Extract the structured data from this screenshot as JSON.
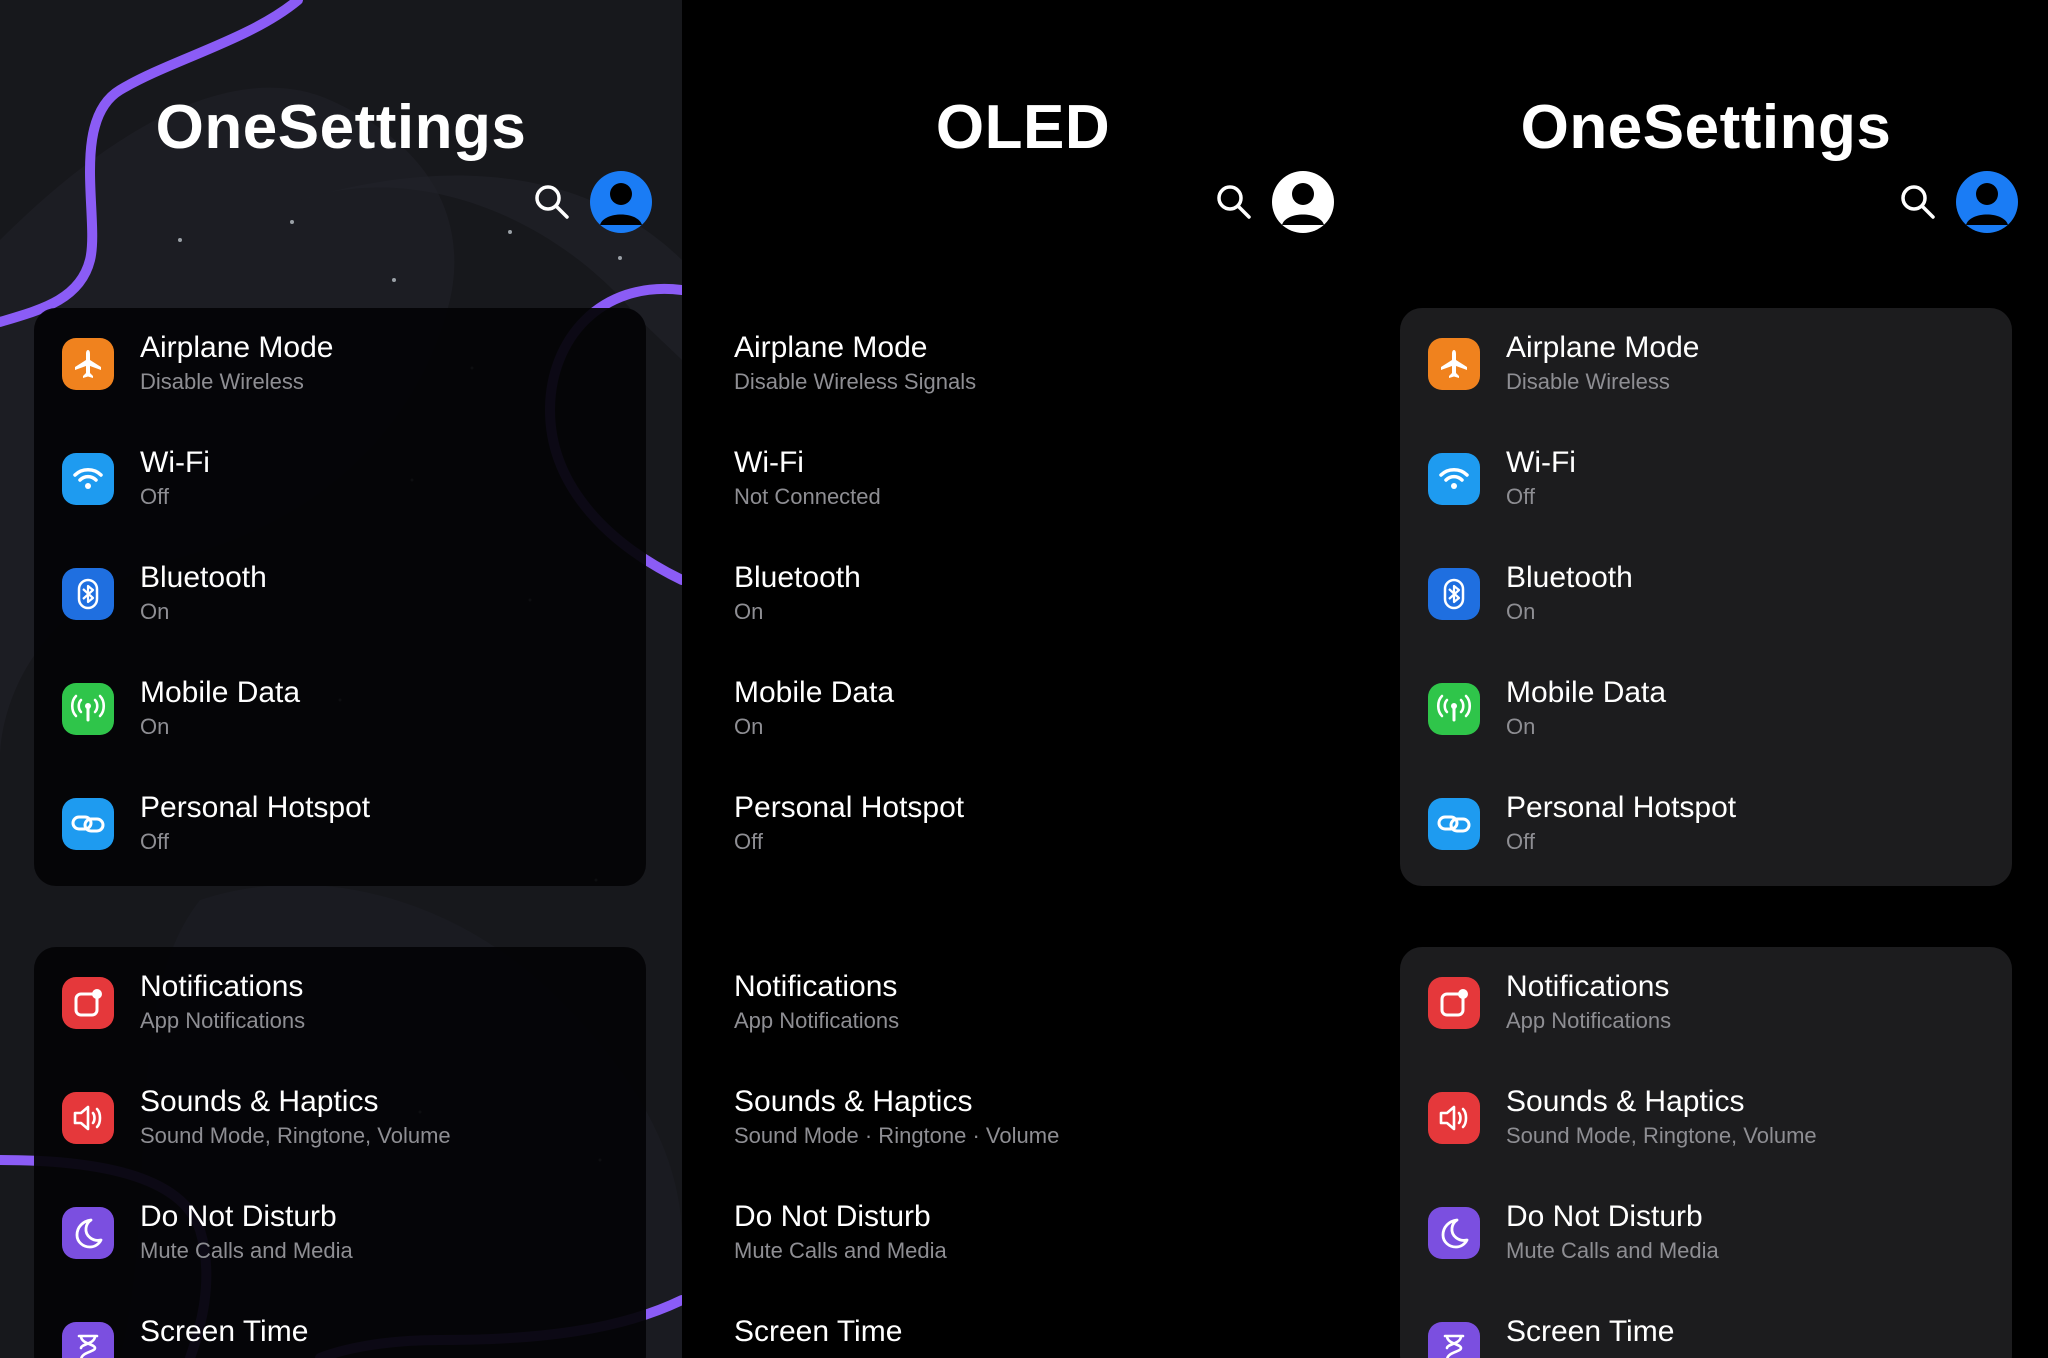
{
  "colors": {
    "accent_purple": "#8b5cf6",
    "avatar_blue": "#1a7cf5",
    "airplane": "#f0821e",
    "wifi": "#1e9bf0",
    "bluetooth": "#1f6fe0",
    "mobile_data": "#2fc54a",
    "hotspot": "#1e9bf0",
    "notifications": "#e5383b",
    "sounds": "#e5383b",
    "dnd": "#7b4fe0",
    "screen_time": "#7b4fe0"
  },
  "panels": [
    {
      "title": "OneSettings",
      "group1": [
        {
          "label": "Airplane Mode",
          "sub": "Disable Wireless",
          "icon": "airplane-icon"
        },
        {
          "label": "Wi-Fi",
          "sub": "Off",
          "icon": "wifi-icon"
        },
        {
          "label": "Bluetooth",
          "sub": "On",
          "icon": "bluetooth-icon"
        },
        {
          "label": "Mobile Data",
          "sub": "On",
          "icon": "antenna-icon"
        },
        {
          "label": "Personal Hotspot",
          "sub": "Off",
          "icon": "link-icon"
        }
      ],
      "group2": [
        {
          "label": "Notifications",
          "sub": "App Notifications",
          "icon": "notification-icon"
        },
        {
          "label": "Sounds & Haptics",
          "sub": "Sound Mode, Ringtone, Volume",
          "icon": "speaker-icon"
        },
        {
          "label": "Do Not Disturb",
          "sub": "Mute Calls and Media",
          "icon": "moon-icon"
        },
        {
          "label": "Screen Time",
          "sub": "",
          "icon": "hourglass-icon"
        }
      ]
    },
    {
      "title": "OLED",
      "group1": [
        {
          "label": "Airplane Mode",
          "sub": "Disable Wireless Signals"
        },
        {
          "label": "Wi-Fi",
          "sub": "Not Connected"
        },
        {
          "label": "Bluetooth",
          "sub": "On"
        },
        {
          "label": "Mobile Data",
          "sub": "On"
        },
        {
          "label": "Personal Hotspot",
          "sub": "Off"
        }
      ],
      "group2": [
        {
          "label": "Notifications",
          "sub": "App Notifications"
        },
        {
          "label": "Sounds & Haptics",
          "sub": "Sound Mode · Ringtone · Volume"
        },
        {
          "label": "Do Not Disturb",
          "sub": "Mute Calls and Media"
        },
        {
          "label": "Screen Time",
          "sub": ""
        }
      ]
    },
    {
      "title": "OneSettings",
      "group1": [
        {
          "label": "Airplane Mode",
          "sub": "Disable Wireless",
          "icon": "airplane-icon"
        },
        {
          "label": "Wi-Fi",
          "sub": "Off",
          "icon": "wifi-icon"
        },
        {
          "label": "Bluetooth",
          "sub": "On",
          "icon": "bluetooth-icon"
        },
        {
          "label": "Mobile Data",
          "sub": "On",
          "icon": "antenna-icon"
        },
        {
          "label": "Personal Hotspot",
          "sub": "Off",
          "icon": "link-icon"
        }
      ],
      "group2": [
        {
          "label": "Notifications",
          "sub": "App Notifications",
          "icon": "notification-icon"
        },
        {
          "label": "Sounds & Haptics",
          "sub": "Sound Mode, Ringtone, Volume",
          "icon": "speaker-icon"
        },
        {
          "label": "Do Not Disturb",
          "sub": "Mute Calls and Media",
          "icon": "moon-icon"
        },
        {
          "label": "Screen Time",
          "sub": "",
          "icon": "hourglass-icon"
        }
      ]
    }
  ]
}
